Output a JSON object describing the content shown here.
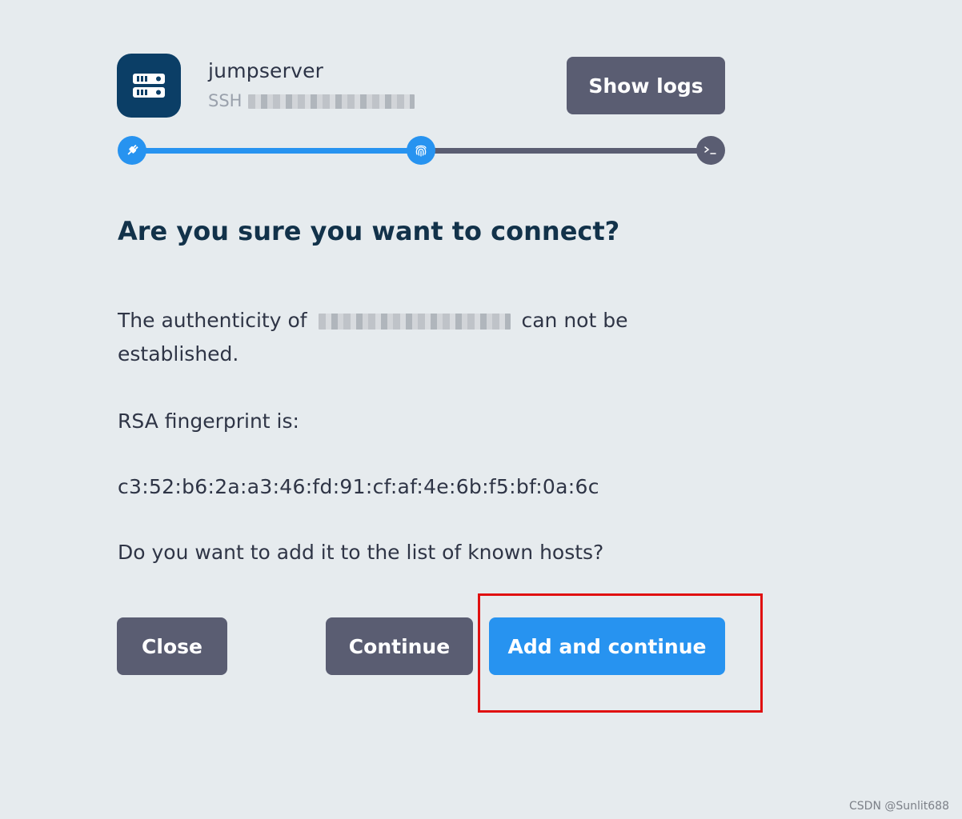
{
  "host": {
    "name": "jumpserver",
    "protocol": "SSH"
  },
  "toolbar": {
    "show_logs_label": "Show logs"
  },
  "progress": {
    "steps": [
      {
        "icon": "plug-icon",
        "state": "complete"
      },
      {
        "icon": "fingerprint-icon",
        "state": "active"
      },
      {
        "icon": "terminal-icon",
        "state": "pending"
      }
    ]
  },
  "dialog": {
    "heading": "Are you sure you want to connect?",
    "authenticity_prefix": "The authenticity of",
    "authenticity_suffix": "can not be established.",
    "rsa_label": "RSA fingerprint is:",
    "fingerprint": "c3:52:b6:2a:a3:46:fd:91:cf:af:4e:6b:f5:bf:0a:6c",
    "question": "Do you want to add it to the list of known hosts?"
  },
  "actions": {
    "close_label": "Close",
    "continue_label": "Continue",
    "add_continue_label": "Add and continue"
  },
  "watermark": "CSDN @Sunlit688",
  "colors": {
    "background": "#e6ebee",
    "accent": "#2793f0",
    "button_gray": "#5a5d72",
    "host_icon_bg": "#0b3e66",
    "heading": "#12324a",
    "highlight": "#e01010"
  }
}
